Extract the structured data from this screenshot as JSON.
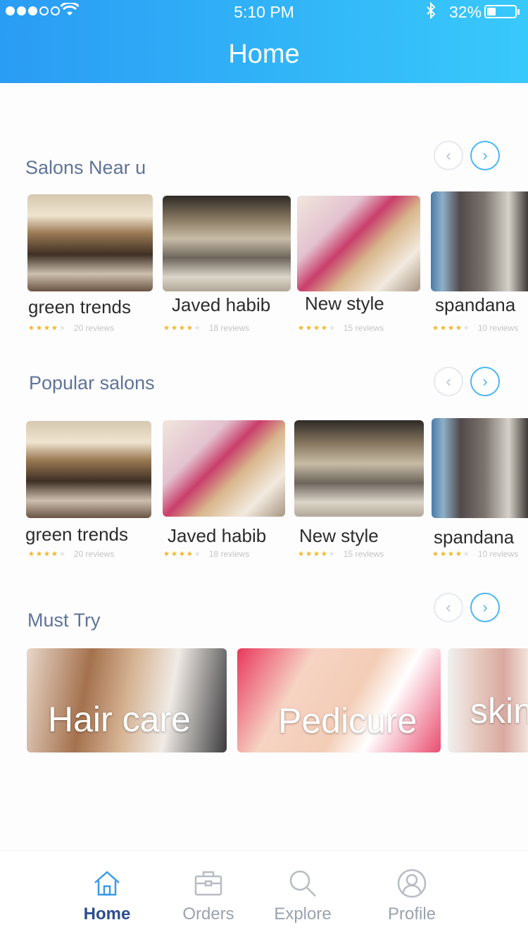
{
  "status_bar": {
    "time": "5:10 PM",
    "battery": "32%",
    "battery_level": 0.32
  },
  "header": {
    "title": "Home"
  },
  "sections": {
    "near": {
      "title": "Salons Near u",
      "items": [
        {
          "name": "green trends",
          "reviews": "20 reviews",
          "rating": 4
        },
        {
          "name": "Javed habib",
          "reviews": "18 reviews",
          "rating": 4
        },
        {
          "name": "New style",
          "reviews": "15 reviews",
          "rating": 4
        },
        {
          "name": "spandana",
          "reviews": "10 reviews",
          "rating": 4
        }
      ]
    },
    "popular": {
      "title": "Popular salons",
      "items": [
        {
          "name": "green trends",
          "reviews": "20 reviews",
          "rating": 4
        },
        {
          "name": "Javed habib",
          "reviews": "18 reviews",
          "rating": 4
        },
        {
          "name": "New style",
          "reviews": "15 reviews",
          "rating": 4
        },
        {
          "name": "spandana",
          "reviews": "10 reviews",
          "rating": 4
        }
      ]
    },
    "must_try": {
      "title": "Must Try",
      "items": [
        {
          "label": "Hair care"
        },
        {
          "label": "Pedicure"
        },
        {
          "label": "skin"
        }
      ]
    }
  },
  "carousel_nav": {
    "prev": "‹",
    "next": "›"
  },
  "tabbar": {
    "items": [
      {
        "label": "Home",
        "icon": "home-icon",
        "active": true
      },
      {
        "label": "Orders",
        "icon": "briefcase-icon",
        "active": false
      },
      {
        "label": "Explore",
        "icon": "search-icon",
        "active": false
      },
      {
        "label": "Profile",
        "icon": "user-icon",
        "active": false
      }
    ]
  },
  "colors": {
    "header_start": "#2a9cf4",
    "header_end": "#38c9fb",
    "active_tab": "#2d4e8f",
    "section_title": "#5f7498",
    "star": "#f6b41c"
  }
}
